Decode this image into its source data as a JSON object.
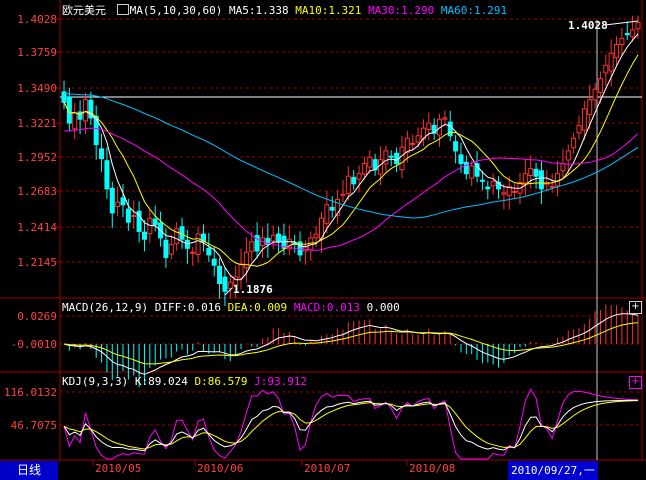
{
  "footer": {
    "period_tab": "日线",
    "cursor_date": "2010/09/27,一"
  },
  "panels": {
    "price": {
      "symbol": "欧元美元",
      "indicator": "MA(5,10,30,60)",
      "ma5": "MA5:1.338",
      "ma10": "MA10:1.321",
      "ma30": "MA30:1.290",
      "ma60": "MA60:1.291",
      "high_label": "1.4028",
      "low_label": "1.1876"
    },
    "macd": {
      "indicator": "MACD(26,12,9)",
      "diff": "DIFF:0.016",
      "dea": "DEA:0.009",
      "macd": "MACD:0.013",
      "extra": "0.000"
    },
    "kdj": {
      "indicator": "KDJ(9,3,3)",
      "k": "K:89.024",
      "d": "D:86.579",
      "j": "J:93.912"
    }
  },
  "colors": {
    "up": "#ff3030",
    "down": "#00ffff",
    "grid": "#9a0000",
    "axis": "#a00000",
    "ma5": "#ffffff",
    "ma10": "#ffff00",
    "ma30": "#ff00ff",
    "ma60": "#00c0ff",
    "text": "#ffffff",
    "cursor": "#c8c8c8"
  },
  "chart_data": [
    {
      "type": "candlestick",
      "title": "欧元美元",
      "y_ticks": [
        "1.4028",
        "1.3759",
        "1.3490",
        "1.3221",
        "1.2952",
        "1.2683",
        "1.2414",
        "1.2145"
      ],
      "x_ticks": [
        "2010/05",
        "2010/06",
        "2010/07",
        "2010/08"
      ],
      "ylim": [
        1.1876,
        1.4028
      ],
      "close": [
        1.338,
        1.322,
        1.33,
        1.325,
        1.34,
        1.326,
        1.305,
        1.294,
        1.27,
        1.252,
        1.26,
        1.258,
        1.245,
        1.25,
        1.238,
        1.232,
        1.248,
        1.243,
        1.233,
        1.218,
        1.228,
        1.24,
        1.232,
        1.225,
        1.222,
        1.236,
        1.23,
        1.22,
        1.212,
        1.198,
        1.192,
        1.199,
        1.203,
        1.213,
        1.222,
        1.23,
        1.223,
        1.233,
        1.228,
        1.235,
        1.23,
        1.225,
        1.232,
        1.228,
        1.22,
        1.226,
        1.233,
        1.236,
        1.248,
        1.258,
        1.254,
        1.262,
        1.266,
        1.28,
        1.274,
        1.282,
        1.29,
        1.295,
        1.285,
        1.293,
        1.3,
        1.295,
        1.29,
        1.303,
        1.31,
        1.306,
        1.312,
        1.318,
        1.322,
        1.314,
        1.325,
        1.326,
        1.312,
        1.3,
        1.29,
        1.282,
        1.288,
        1.28,
        1.276,
        1.27,
        1.276,
        1.27,
        1.267,
        1.272,
        1.268,
        1.275,
        1.282,
        1.286,
        1.28,
        1.27,
        1.275,
        1.272,
        1.282,
        1.29,
        1.3,
        1.31,
        1.32,
        1.333,
        1.34,
        1.348,
        1.356,
        1.366,
        1.375,
        1.382,
        1.387,
        1.39,
        1.394,
        1.4
      ],
      "ma5": "MA5:1.338",
      "ma10": "MA10:1.321",
      "ma30": "MA30:1.290",
      "ma60": "MA60:1.291",
      "annotations": [
        "1.4028",
        "1.1876"
      ]
    },
    {
      "type": "macd",
      "y_ticks": [
        "0.0269",
        "-0.0010"
      ],
      "diff": 0.016,
      "dea": 0.009,
      "macd": 0.013
    },
    {
      "type": "kdj",
      "y_ticks": [
        "116.0132",
        "46.7075"
      ],
      "k": 89.024,
      "d": 86.579,
      "j": 93.912
    }
  ]
}
